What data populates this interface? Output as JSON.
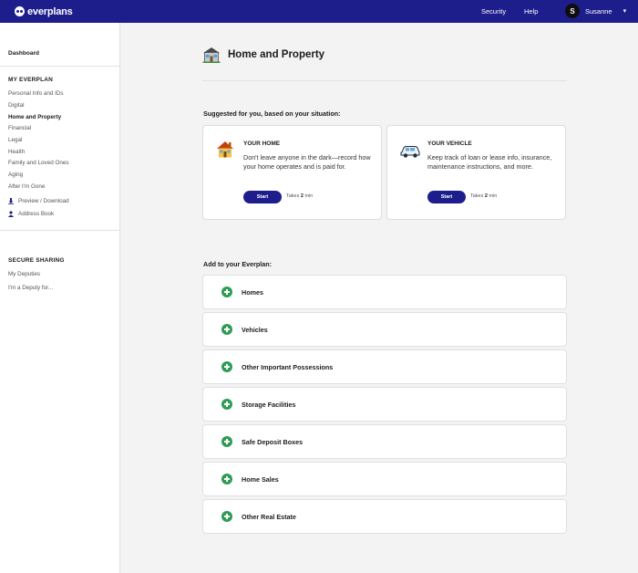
{
  "header": {
    "logo_text": "everplans",
    "nav": [
      "Security",
      "Help"
    ],
    "user": {
      "initial": "S",
      "name": "Susanne"
    },
    "color": "#1e1d8c"
  },
  "sidebar": {
    "dashboard": "Dashboard",
    "my_everplan_heading": "MY EVERPLAN",
    "items": [
      "Personal Info and IDs",
      "Digital",
      "Home and Property",
      "Financial",
      "Legal",
      "Health",
      "Family and Loved Ones",
      "Aging",
      "After I'm Gone"
    ],
    "active_item": "Home and Property",
    "utilities": [
      {
        "label": "Preview / Download",
        "icon": "download-icon"
      },
      {
        "label": "Address Book",
        "icon": "address-book-icon"
      }
    ],
    "secure_sharing_heading": "SECURE SHARING",
    "sharing_items": [
      "My Deputies",
      "I'm a Deputy for..."
    ]
  },
  "main": {
    "title": "Home and Property",
    "title_icon": "house-icon",
    "suggested_label": "Suggested for you, based on your situation:",
    "cards": [
      {
        "title": "YOUR HOME",
        "icon": "house-emoji-icon",
        "description": "Don't leave anyone in the dark—record how your home operates and is paid for.",
        "button": "Start",
        "takes_prefix": "Takes",
        "takes_value": "2",
        "takes_suffix": "min"
      },
      {
        "title": "YOUR VEHICLE",
        "icon": "car-icon",
        "description": "Keep track of loan or lease info, insurance, maintenance instructions, and more.",
        "button": "Start",
        "takes_prefix": "Takes",
        "takes_value": "2",
        "takes_suffix": "min"
      }
    ],
    "add_label": "Add to your Everplan:",
    "add_items": [
      "Homes",
      "Vehicles",
      "Other Important Possessions",
      "Storage Facilities",
      "Safe Deposit Boxes",
      "Home Sales",
      "Other Real Estate"
    ],
    "accent_green": "#2f9c55"
  }
}
